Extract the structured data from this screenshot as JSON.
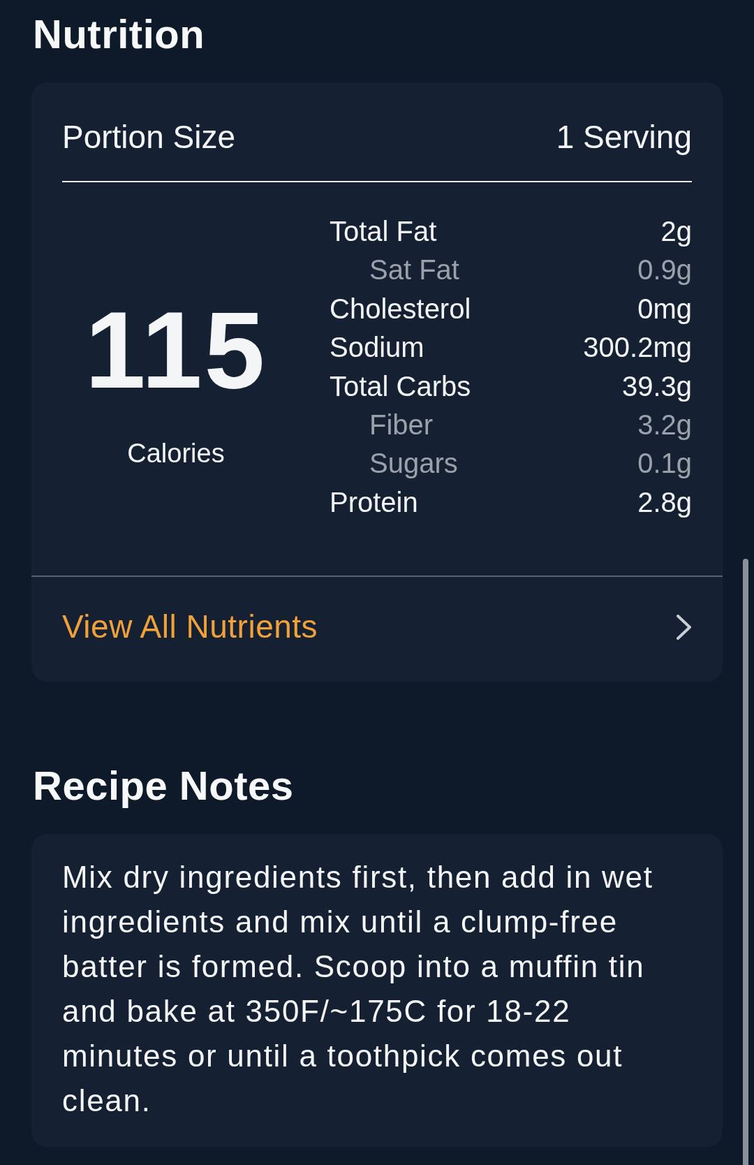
{
  "nutrition": {
    "title": "Nutrition",
    "portion": {
      "label": "Portion Size",
      "value": "1 Serving"
    },
    "calories": {
      "value": "115",
      "label": "Calories"
    },
    "nutrients": [
      {
        "name": "Total Fat",
        "amount": "2g",
        "sub": false
      },
      {
        "name": "Sat Fat",
        "amount": "0.9g",
        "sub": true
      },
      {
        "name": "Cholesterol",
        "amount": "0mg",
        "sub": false
      },
      {
        "name": "Sodium",
        "amount": "300.2mg",
        "sub": false
      },
      {
        "name": "Total Carbs",
        "amount": "39.3g",
        "sub": false
      },
      {
        "name": "Fiber",
        "amount": "3.2g",
        "sub": true
      },
      {
        "name": "Sugars",
        "amount": "0.1g",
        "sub": true
      },
      {
        "name": "Protein",
        "amount": "2.8g",
        "sub": false
      }
    ],
    "link": {
      "label": "View All Nutrients"
    }
  },
  "recipe_notes": {
    "title": "Recipe Notes",
    "text": "Mix dry ingredients first, then add in wet ingredients and mix until a clump-free batter is formed. Scoop into a muffin tin and bake at 350F/~175C for 18-22 minutes or until a toothpick comes out clean."
  }
}
